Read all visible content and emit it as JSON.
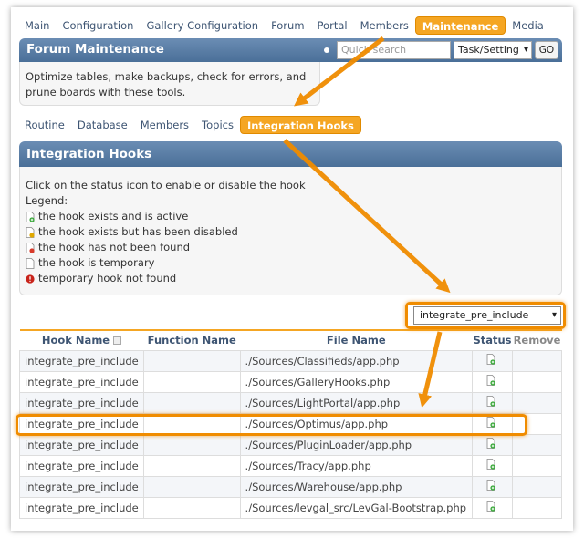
{
  "topnav": [
    {
      "label": "Main",
      "active": false
    },
    {
      "label": "Configuration",
      "active": false
    },
    {
      "label": "Gallery Configuration",
      "active": false
    },
    {
      "label": "Forum",
      "active": false
    },
    {
      "label": "Portal",
      "active": false
    },
    {
      "label": "Members",
      "active": false
    },
    {
      "label": "Maintenance",
      "active": true
    },
    {
      "label": "Media",
      "active": false
    }
  ],
  "header": {
    "title": "Forum Maintenance",
    "search_placeholder": "Quick search",
    "search_scope": "Task/Setting",
    "go_label": "GO"
  },
  "description": "Optimize tables, make backups, check for errors, and prune boards with these tools.",
  "subtabs": [
    {
      "label": "Routine",
      "active": false
    },
    {
      "label": "Database",
      "active": false
    },
    {
      "label": "Members",
      "active": false
    },
    {
      "label": "Topics",
      "active": false
    },
    {
      "label": "Integration Hooks",
      "active": true
    }
  ],
  "section": {
    "title": "Integration Hooks",
    "intro": "Click on the status icon to enable or disable the hook",
    "legend_title": "Legend:",
    "legend": [
      {
        "icon": "hook-active-icon",
        "text": "the hook exists and is active"
      },
      {
        "icon": "hook-disabled-icon",
        "text": "the hook exists but has been disabled"
      },
      {
        "icon": "hook-not-found-icon",
        "text": "the hook has not been found"
      },
      {
        "icon": "hook-temporary-icon",
        "text": "the hook is temporary"
      },
      {
        "icon": "temporary-not-found-icon",
        "text": "temporary hook not found"
      }
    ]
  },
  "filter": {
    "selected": "integrate_pre_include"
  },
  "table": {
    "columns": [
      "Hook Name",
      "Function Name",
      "File Name",
      "Status",
      "Remove"
    ],
    "rows": [
      {
        "hook": "integrate_pre_include",
        "function": "",
        "file": "./Sources/Classifieds/app.php",
        "status": "hook-active-icon"
      },
      {
        "hook": "integrate_pre_include",
        "function": "",
        "file": "./Sources/GalleryHooks.php",
        "status": "hook-active-icon"
      },
      {
        "hook": "integrate_pre_include",
        "function": "",
        "file": "./Sources/LightPortal/app.php",
        "status": "hook-active-icon"
      },
      {
        "hook": "integrate_pre_include",
        "function": "",
        "file": "./Sources/Optimus/app.php",
        "status": "hook-active-icon"
      },
      {
        "hook": "integrate_pre_include",
        "function": "",
        "file": "./Sources/PluginLoader/app.php",
        "status": "hook-active-icon"
      },
      {
        "hook": "integrate_pre_include",
        "function": "",
        "file": "./Sources/Tracy/app.php",
        "status": "hook-active-icon"
      },
      {
        "hook": "integrate_pre_include",
        "function": "",
        "file": "./Sources/Warehouse/app.php",
        "status": "hook-active-icon"
      },
      {
        "hook": "integrate_pre_include",
        "function": "",
        "file": "./Sources/levgal_src/LevGal-Bootstrap.php",
        "status": "hook-active-icon"
      }
    ]
  },
  "colors": {
    "accent": "#f5a623",
    "annotation": "#f08c00",
    "header_bar": "#5a7ea8",
    "link": "#3e5573"
  }
}
